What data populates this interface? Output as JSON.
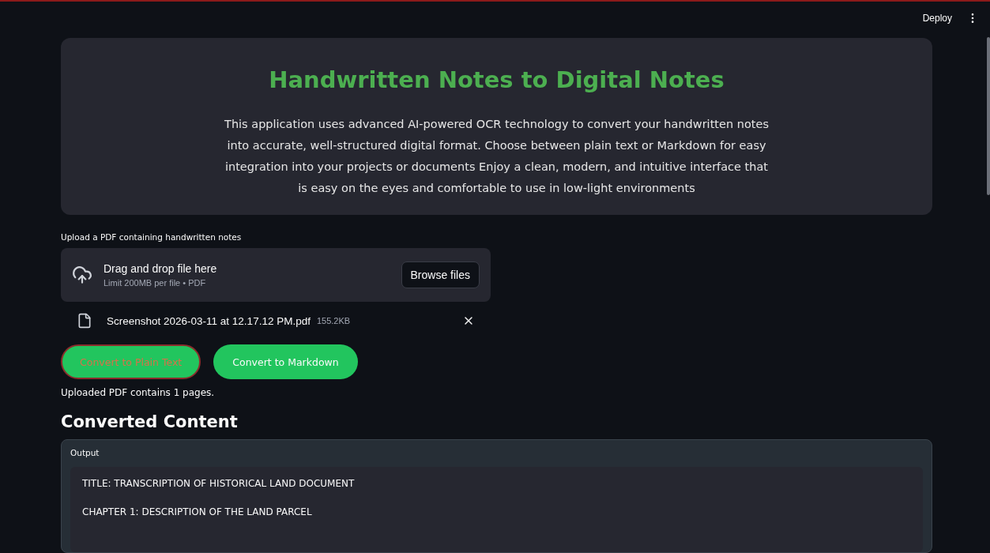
{
  "header": {
    "deploy": "Deploy"
  },
  "hero": {
    "title": "Handwritten Notes to Digital Notes",
    "description": "This application uses advanced AI-powered OCR technology to convert your handwritten notes into accurate, well-structured digital format. Choose between plain text or Markdown for easy integration into your projects or documents Enjoy a clean, modern, and intuitive interface that is easy on the eyes and comfortable to use in low-light environments"
  },
  "uploader": {
    "label": "Upload a PDF containing handwritten notes",
    "drop_title": "Drag and drop file here",
    "drop_hint": "Limit 200MB per file • PDF",
    "browse": "Browse files",
    "file": {
      "name": "Screenshot 2026-03-11 at 12.17.12 PM.pdf",
      "size": "155.2KB"
    }
  },
  "actions": [
    {
      "label": "Convert to Plain Text",
      "focused": true
    },
    {
      "label": "Convert to Markdown",
      "focused": false
    }
  ],
  "status": "Uploaded PDF contains 1 pages.",
  "output": {
    "heading": "Converted Content",
    "label": "Output",
    "lines": [
      "TITLE: TRANSCRIPTION OF HISTORICAL LAND DOCUMENT",
      "CHAPTER 1: DESCRIPTION OF THE LAND PARCEL"
    ]
  }
}
